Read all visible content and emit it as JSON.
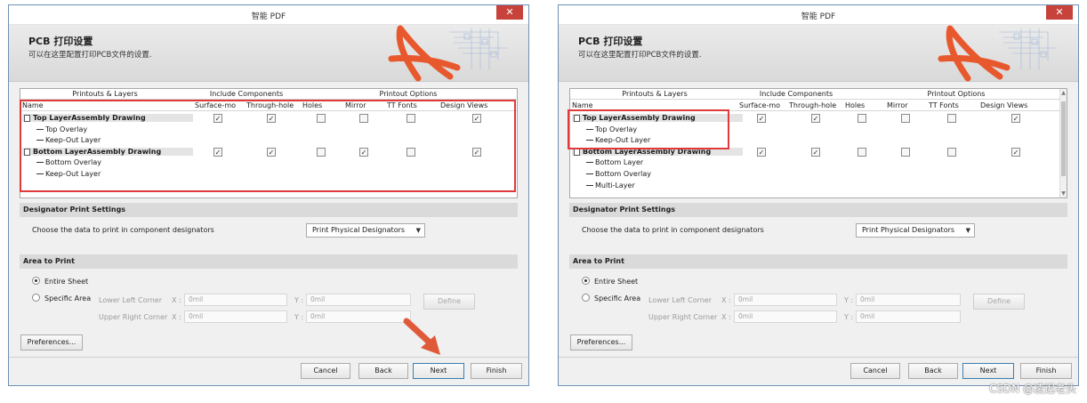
{
  "windows": [
    {
      "title": "智能 PDF",
      "close_glyph": "✕",
      "banner": {
        "title": "PCB 打印设置",
        "subtitle": "可以在这里配置打印PCB文件的设置."
      },
      "table": {
        "groups": [
          "Printouts & Layers",
          "Include Components",
          "Printout Options"
        ],
        "columns": [
          "Name",
          "Surface-mo",
          "Through-hole",
          "Holes",
          "Mirror",
          "TT Fonts",
          "Design Views"
        ],
        "rows": [
          {
            "label": "Top LayerAssembly Drawing",
            "kind": "parent",
            "checks": [
              true,
              true,
              false,
              false,
              false,
              true
            ]
          },
          {
            "label": "Top Overlay",
            "kind": "child"
          },
          {
            "label": "Keep-Out Layer",
            "kind": "child"
          },
          {
            "label": "Bottom LayerAssembly Drawing",
            "kind": "parent",
            "checks": [
              true,
              true,
              false,
              true,
              false,
              true
            ]
          },
          {
            "label": "Bottom Overlay",
            "kind": "child"
          },
          {
            "label": "Keep-Out Layer",
            "kind": "child"
          }
        ]
      },
      "designator": {
        "header": "Designator Print Settings",
        "prompt": "Choose the data to print in component designators",
        "selected": "Print Physical Designators"
      },
      "area": {
        "header": "Area to Print",
        "entire": "Entire Sheet",
        "specific": "Specific Area",
        "lower_left": "Lower Left Corner",
        "upper_right": "Upper Right Corner",
        "x_label": "X :",
        "y_label": "Y :",
        "ll_x": "0mil",
        "ll_y": "0mil",
        "ur_x": "0mil",
        "ur_y": "0mil",
        "define": "Define",
        "selected": "Entire Sheet"
      },
      "preferences": "Preferences...",
      "buttons": {
        "cancel": "Cancel",
        "back": "Back",
        "next": "Next",
        "finish": "Finish"
      }
    },
    {
      "title": "智能 PDF",
      "close_glyph": "✕",
      "banner": {
        "title": "PCB 打印设置",
        "subtitle": "可以在这里配置打印PCB文件的设置."
      },
      "table": {
        "groups": [
          "Printouts & Layers",
          "Include Components",
          "Printout Options"
        ],
        "columns": [
          "Name",
          "Surface-mo",
          "Through-hole",
          "Holes",
          "Mirror",
          "TT Fonts",
          "Design Views"
        ],
        "rows": [
          {
            "label": "Top LayerAssembly Drawing",
            "kind": "parent",
            "checks": [
              true,
              true,
              false,
              false,
              false,
              true
            ]
          },
          {
            "label": "Top Overlay",
            "kind": "child"
          },
          {
            "label": "Keep-Out Layer",
            "kind": "child"
          },
          {
            "label": "Bottom LayerAssembly Drawing",
            "kind": "parent",
            "checks": [
              true,
              true,
              false,
              false,
              false,
              true
            ]
          },
          {
            "label": "Bottom Layer",
            "kind": "child"
          },
          {
            "label": "Bottom Overlay",
            "kind": "child"
          },
          {
            "label": "Multi-Layer",
            "kind": "child"
          }
        ]
      },
      "designator": {
        "header": "Designator Print Settings",
        "prompt": "Choose the data to print in component designators",
        "selected": "Print Physical Designators"
      },
      "area": {
        "header": "Area to Print",
        "entire": "Entire Sheet",
        "specific": "Specific Area",
        "lower_left": "Lower Left Corner",
        "upper_right": "Upper Right Corner",
        "x_label": "X :",
        "y_label": "Y :",
        "ll_x": "0mil",
        "ll_y": "0mil",
        "ur_x": "0mil",
        "ur_y": "0mil",
        "define": "Define",
        "selected": "Entire Sheet"
      },
      "preferences": "Preferences...",
      "buttons": {
        "cancel": "Cancel",
        "back": "Back",
        "next": "Next",
        "finish": "Finish"
      }
    }
  ],
  "watermark": "CSDN @凌迟老头",
  "colors": {
    "highlight_red": "#e03a3a",
    "close_red": "#c7423a",
    "pdf_orange": "#e8582d"
  },
  "icons": [
    "close-icon",
    "pdf-logo-icon",
    "document-icon",
    "checkbox",
    "radio",
    "dropdown-caret-icon",
    "red-arrow-icon"
  ]
}
